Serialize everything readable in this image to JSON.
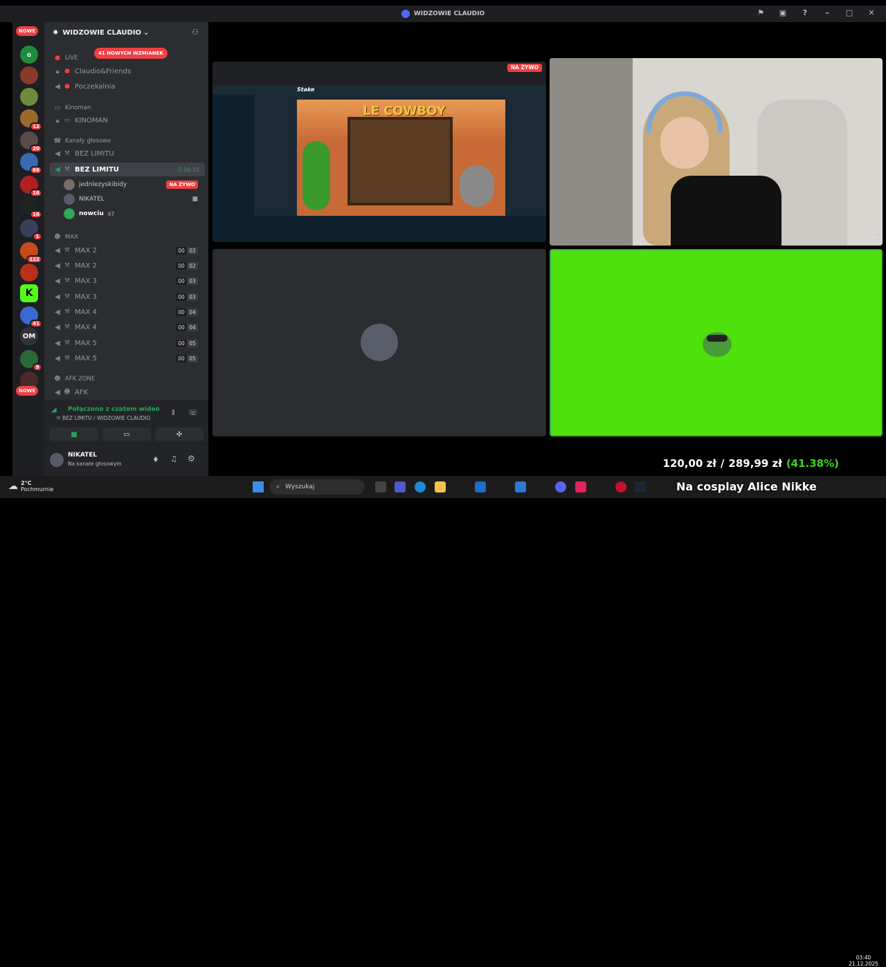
{
  "window": {
    "title": "WIDZOWIE CLAUDIO"
  },
  "rail": {
    "top_pill": "NOWE",
    "bottom_pill": "NOWE",
    "servers": [
      {
        "icon": "server-green-icon",
        "badge": ""
      },
      {
        "icon": "server-icon",
        "badge": ""
      },
      {
        "icon": "server-icon",
        "badge": ""
      },
      {
        "icon": "server-icon",
        "badge": "12"
      },
      {
        "icon": "server-icon",
        "badge": "20"
      },
      {
        "icon": "server-icon",
        "badge": "66"
      },
      {
        "icon": "server-icon",
        "badge": "16"
      },
      {
        "icon": "server-icon",
        "badge": "16"
      },
      {
        "icon": "server-icon",
        "badge": "1"
      },
      {
        "icon": "server-icon",
        "badge": "122"
      },
      {
        "icon": "server-icon",
        "badge": ""
      },
      {
        "icon": "kick-icon",
        "badge": ""
      },
      {
        "icon": "server-icon",
        "badge": "41"
      },
      {
        "icon": "server-text-icon",
        "label": "OM",
        "badge": ""
      },
      {
        "icon": "server-icon",
        "badge": "9"
      },
      {
        "icon": "server-icon",
        "badge": ""
      }
    ]
  },
  "sidebar": {
    "server_name": "WIDZOWIE CLAUDIO",
    "mentions": "41 NOWYCH WZMIANEK",
    "live_category": "LIVE",
    "live_channels": [
      "Claudio&Friends",
      "Poczekalnia"
    ],
    "kinoman_category": "Kinoman",
    "kinoman_channel": "KINOMAN",
    "voice_category": "Kanały głosowe",
    "voice_channels": [
      "BEZ LIMITU",
      "BEZ LIMITU"
    ],
    "active_time": "2:16:21",
    "users": [
      {
        "name": "jednlezyskibidy",
        "live": "NA ŻYWO"
      },
      {
        "name": "NIKATEL",
        "live": ""
      },
      {
        "name": "nowciu",
        "extra": "67"
      }
    ],
    "max_category": "MAX",
    "max_channels": [
      {
        "name": "MAX 2",
        "a": "00",
        "b": "02"
      },
      {
        "name": "MAX 2",
        "a": "00",
        "b": "02"
      },
      {
        "name": "MAX 3",
        "a": "00",
        "b": "03"
      },
      {
        "name": "MAX 3",
        "a": "00",
        "b": "03"
      },
      {
        "name": "MAX 4",
        "a": "00",
        "b": "04"
      },
      {
        "name": "MAX 4",
        "a": "00",
        "b": "04"
      },
      {
        "name": "MAX 5",
        "a": "00",
        "b": "05"
      },
      {
        "name": "MAX 5",
        "a": "00",
        "b": "05"
      }
    ],
    "afk_category": "AFK ZONE",
    "afk_channel": "AFK"
  },
  "voice_panel": {
    "title": "Połączono z czatem wideo",
    "subtitle": "BEZ LIMITU / WIDZOWIE CLAUDIO"
  },
  "user_panel": {
    "name": "NIKATEL",
    "status": "Na kanale głosowym"
  },
  "stream": {
    "live_label": "NA ŻYWO",
    "game_title": "LE COWBOY",
    "site": "Stake"
  },
  "overlay": {
    "amount": "120,00 zł",
    "separator": "/",
    "goal": "289,99 zł",
    "percent": "(41.38%)",
    "progress": 0.4138
  },
  "ticker": "Na cosplay Alice Nikke",
  "taskbar": {
    "temp": "2°C",
    "weather": "Pochmurnie",
    "search": "Wyszukaj",
    "time": "03:40",
    "date": "21.12.2025"
  },
  "colors": {
    "accent_red": "#f23f43",
    "green_screen": "#4ee10b",
    "discord_bg": "#2b2d31"
  }
}
